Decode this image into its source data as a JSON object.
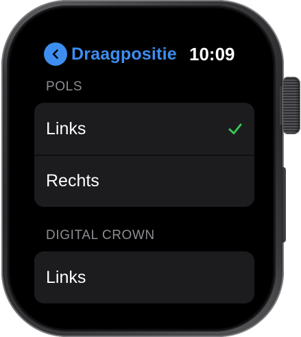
{
  "header": {
    "back_title": "Draagpositie",
    "time": "10:09"
  },
  "sections": [
    {
      "label": "POLS",
      "items": [
        {
          "label": "Links",
          "selected": true
        },
        {
          "label": "Rechts",
          "selected": false
        }
      ]
    },
    {
      "label": "DIGITAL CROWN",
      "items": [
        {
          "label": "Links",
          "selected": false
        }
      ]
    }
  ],
  "colors": {
    "accent": "#3d8ef0",
    "check": "#34c759",
    "row_bg": "#1c1c1e",
    "section_label": "#8e8e93"
  },
  "icons": {
    "back": "chevron-left-icon",
    "selected": "checkmark-icon"
  }
}
